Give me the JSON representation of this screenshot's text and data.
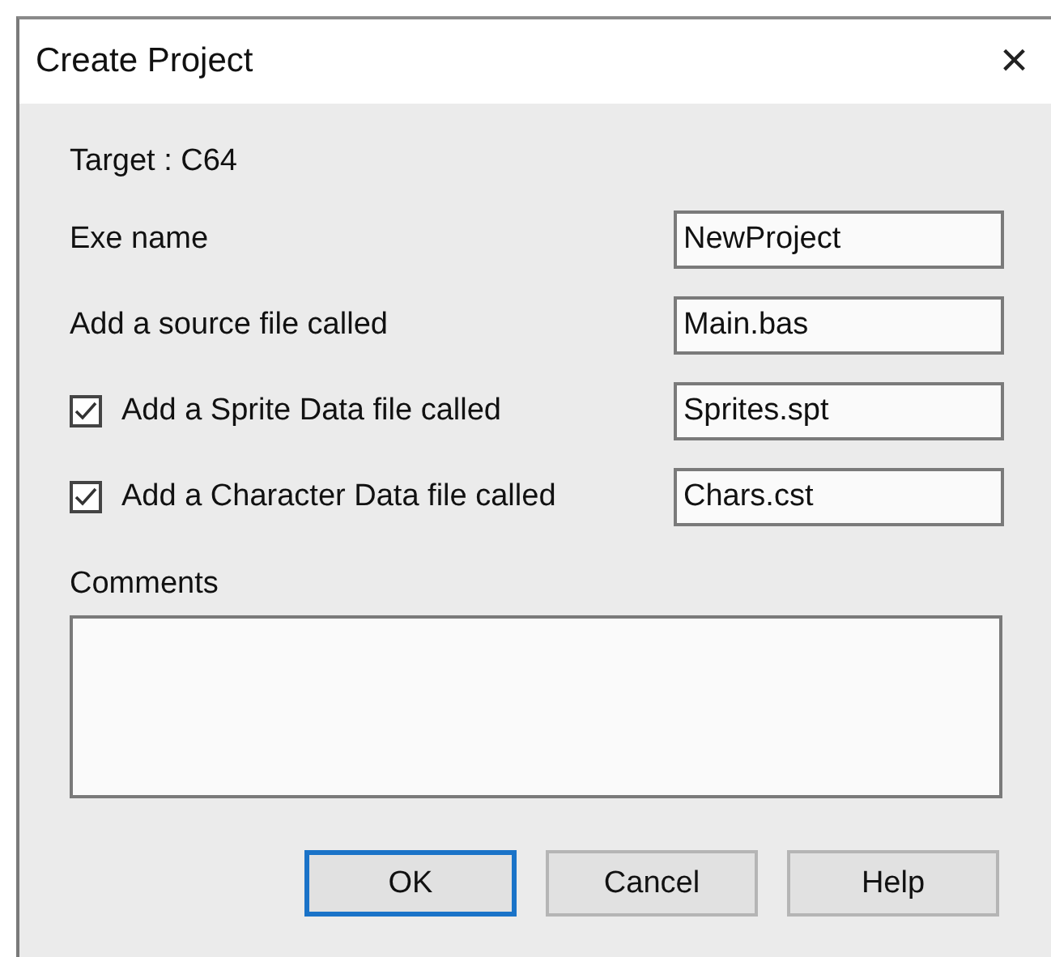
{
  "window": {
    "title": "Create Project",
    "close": "×"
  },
  "target": "Target : C64",
  "rows": [
    {
      "kind": "text",
      "label": "Exe name",
      "value": "NewProject"
    },
    {
      "kind": "text",
      "label": "Add a source file called",
      "value": "Main.bas"
    },
    {
      "kind": "checkbox",
      "label": "Add a Sprite Data file called",
      "checked": true,
      "value": "Sprites.spt"
    },
    {
      "kind": "checkbox",
      "label": "Add a Character Data file called",
      "checked": true,
      "value": "Chars.cst"
    }
  ],
  "comments": {
    "label": "Comments"
  },
  "buttons": [
    {
      "label": "OK",
      "default": true
    },
    {
      "label": "Cancel",
      "default": false
    },
    {
      "label": "Help",
      "default": false
    }
  ]
}
